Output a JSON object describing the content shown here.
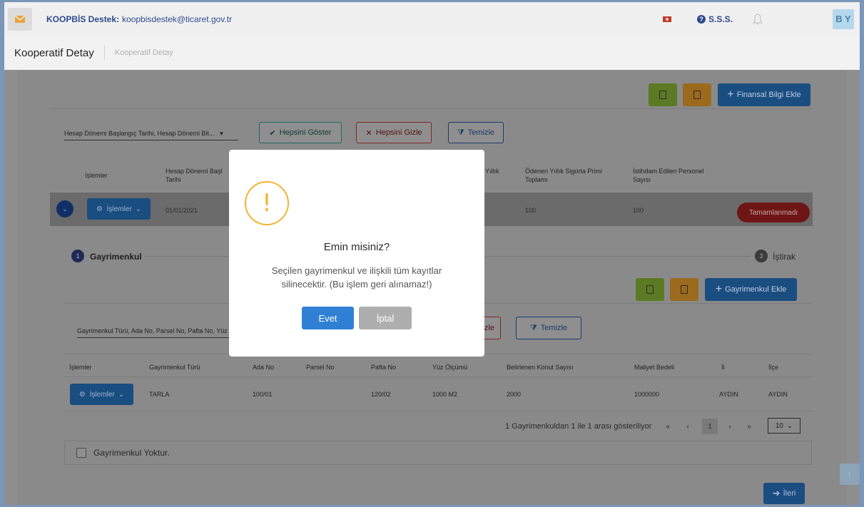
{
  "topbar": {
    "support_label": "KOOPBİS Destek:",
    "support_email": "koopbisdestek@ticaret.gov.tr",
    "faq_label": "S.S.S.",
    "user_initials": "B Y"
  },
  "breadcrumb": {
    "title": "Kooperatif Detay",
    "current": "Kooperatif Detay"
  },
  "financial": {
    "add_button": "Finansal Bilgi Ekle",
    "column_select": "Hesap Dönemi Başlangıç Tarihi, Hesap Dönemi Bit...",
    "show_all": "Hepsini Göster",
    "hide_all": "Hepsini Gizle",
    "clear": "Temizle",
    "headers": {
      "ops": "İşlemler",
      "period_start_1": "Hesap Dönemi Başl",
      "period_start_2": "Tarihi",
      "annual": "Yıllık",
      "insurance_1": "Ödenen Yıllık Sigorta Primi",
      "insurance_2": "Toplamı",
      "staff_1": "İstihdam Edilen Personel",
      "staff_2": "Sayısı"
    },
    "row": {
      "ops_button": "İşlemler",
      "period_start": "01/01/2021",
      "insurance_total": "100",
      "staff_count": "100",
      "status": "Tamamlanmadı"
    }
  },
  "steps": {
    "step1_num": "1",
    "step1_label": "Gayrimenkul",
    "step3_num": "3",
    "step3_label": "İştirak"
  },
  "realestate": {
    "add_button": "Gayrimenkul Ekle",
    "column_select": "Gayrimenkul Türü, Ada No, Parsel No, Pafta No, Yüz Ö",
    "hide_all_partial": "izle",
    "clear": "Temizle",
    "headers": [
      "İşlemler",
      "Gayrimenkul Türü",
      "Ada No",
      "Parsel No",
      "Pafta No",
      "Yüz Ölçümü",
      "Belirlenen Konut Sayısı",
      "Maliyet Bedeli",
      "İl",
      "İlçe"
    ],
    "row": {
      "ops_button": "İşlemler",
      "type": "TARLA",
      "ada": "100/01",
      "pafta": "120/02",
      "area": "1000 M2",
      "houses": "2000",
      "cost": "1000000",
      "city": "AYDIN",
      "district": "AYDIN"
    },
    "pager": {
      "summary": "1 Gayrimenkuldan 1 ile 1 arası gösteriliyor",
      "first": "«",
      "prev": "‹",
      "page": "1",
      "next": "›",
      "last": "»",
      "per_page": "10"
    },
    "none_label": "Gayrimenkul Yoktur."
  },
  "next_button": "İleri",
  "modal": {
    "icon": "!",
    "title": "Emin misiniz?",
    "message": "Seçilen gayrimenkul ve ilişkili tüm kayıtlar silinecektir. (Bu işlem geri alınamaz!)",
    "confirm": "Evet",
    "cancel": "İptal"
  },
  "colors": {
    "primary": "#2f80d5",
    "warning": "#f5b332",
    "danger": "#c62828",
    "success": "#6a9a2b"
  }
}
